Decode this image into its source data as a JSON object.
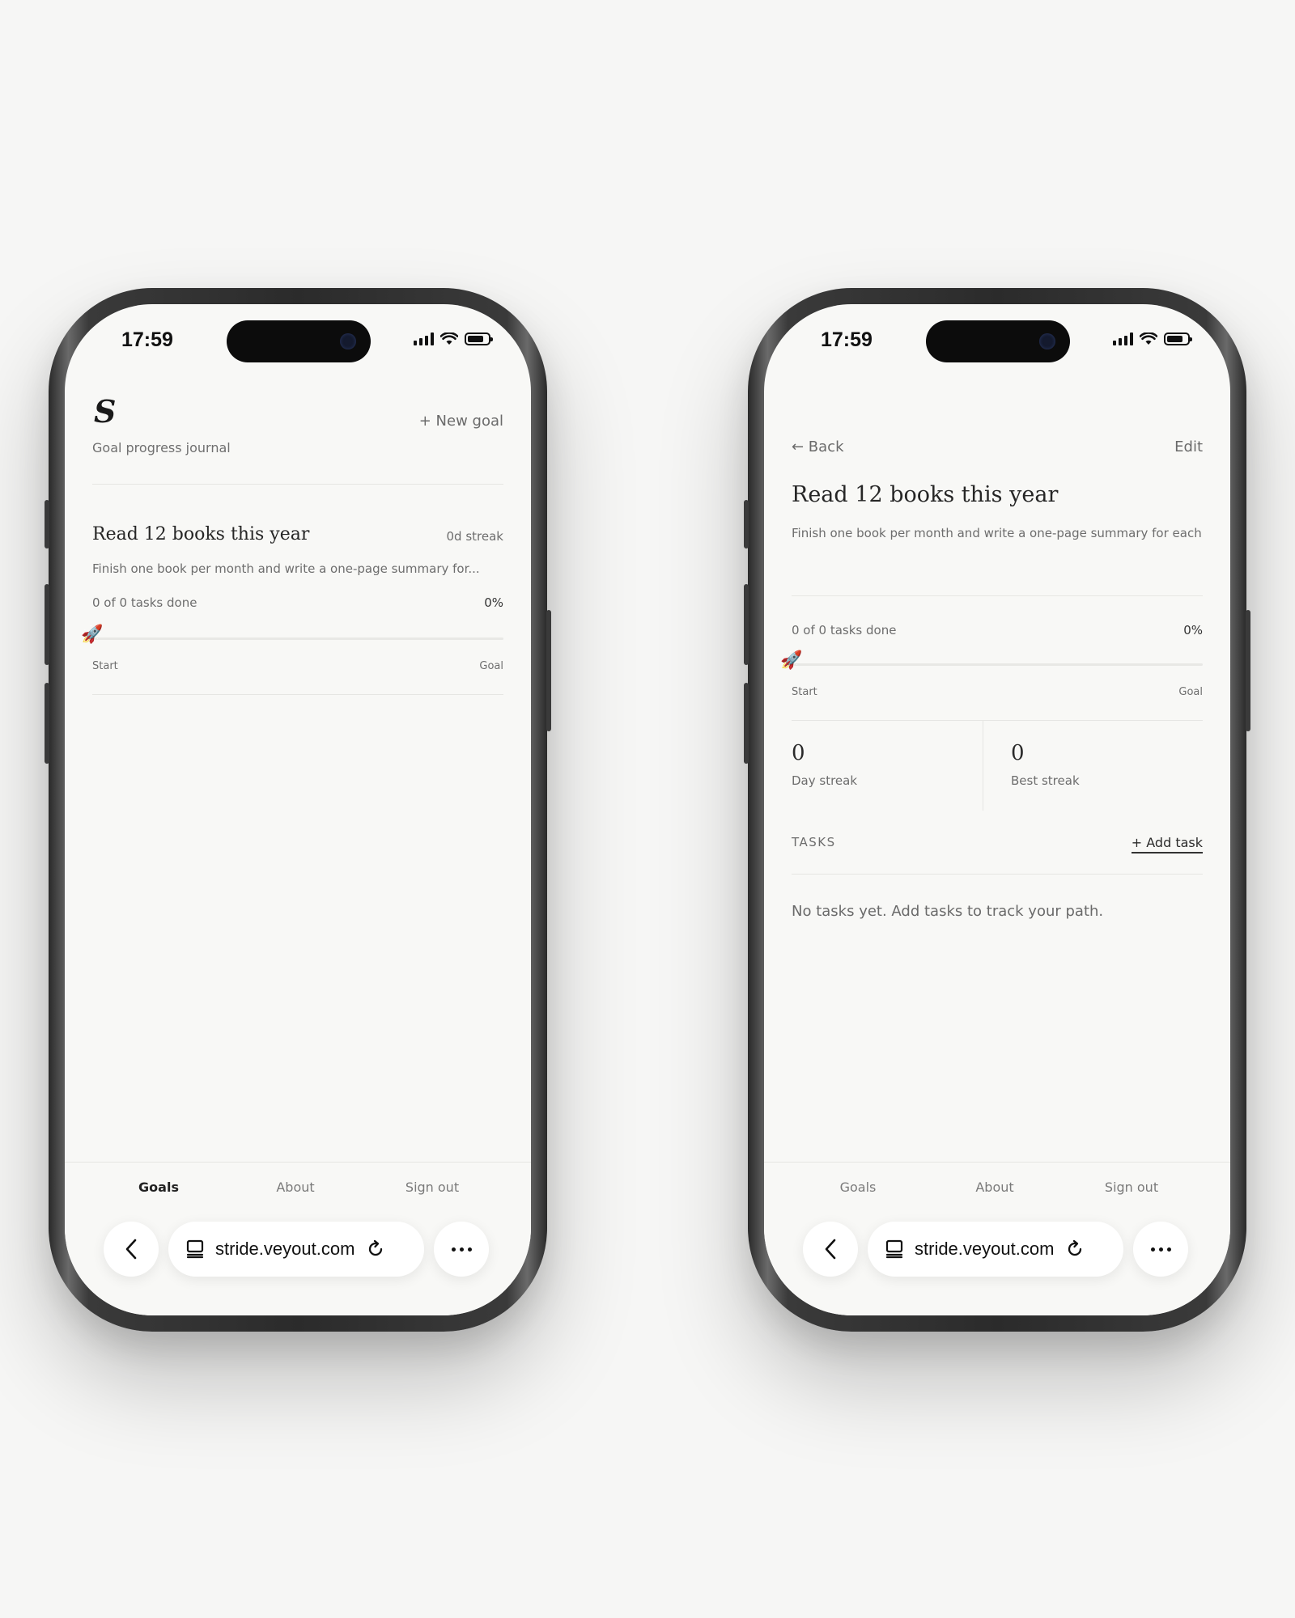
{
  "status": {
    "time": "17:59"
  },
  "browser": {
    "url": "stride.veyout.com"
  },
  "nav": {
    "tabs": [
      "Goals",
      "About",
      "Sign out"
    ]
  },
  "list_screen": {
    "logo": "S",
    "subtitle": "Goal progress journal",
    "new_goal_label": "+ New goal",
    "goal": {
      "title": "Read 12 books this year",
      "streak": "0d streak",
      "description": "Finish one book per month and write a one-page summary for...",
      "tasks_done": "0 of 0 tasks done",
      "percent": "0%",
      "progress": 0,
      "start_label": "Start",
      "goal_label": "Goal"
    },
    "active_tab": "Goals"
  },
  "detail_screen": {
    "back_label": "← Back",
    "edit_label": "Edit",
    "title": "Read 12 books this year",
    "description": "Finish one book per month and write a one-page summary for each",
    "tasks_done": "0 of 0 tasks done",
    "percent": "0%",
    "progress": 0,
    "start_label": "Start",
    "goal_label": "Goal",
    "day_streak_value": "0",
    "day_streak_label": "Day streak",
    "best_streak_value": "0",
    "best_streak_label": "Best streak",
    "tasks_header": "TASKS",
    "add_task_label": "+ Add task",
    "empty_message": "No tasks yet. Add tasks to track your path."
  },
  "icons": {
    "rocket": "rocket-icon",
    "back": "chevron-left-icon",
    "tabs": "tabs-icon",
    "reload": "reload-icon",
    "more": "more-icon"
  }
}
